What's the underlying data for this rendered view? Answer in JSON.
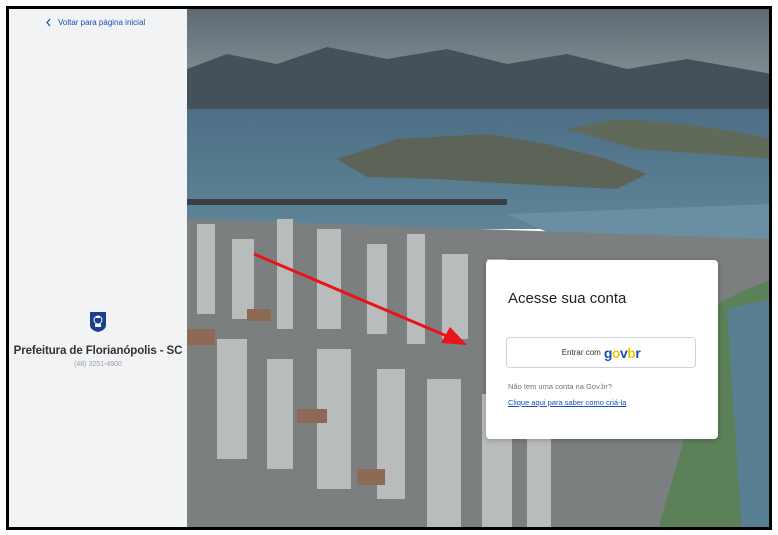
{
  "left_panel": {
    "back_link": "Voltar para página inicial",
    "org_name": "Prefeitura de Florianópolis - SC",
    "phone": "(48) 3251-4900"
  },
  "login_card": {
    "title": "Acesse sua conta",
    "button_prefix": "Entrar com",
    "button_logo": {
      "g": "g",
      "o": "o",
      "v": "v",
      "b": "b",
      "r": "r"
    },
    "no_account_text": "Não tem uma conta na Gov.br?",
    "create_link": "Clique aqui para saber como criá-la"
  },
  "colors": {
    "link": "#1351b4",
    "govbr_blue": "#1351b4",
    "govbr_yellow": "#f8c300",
    "annotation_arrow": "#e8141b"
  },
  "icons": {
    "back": "chevron-left-icon",
    "crest": "city-crest-icon"
  }
}
